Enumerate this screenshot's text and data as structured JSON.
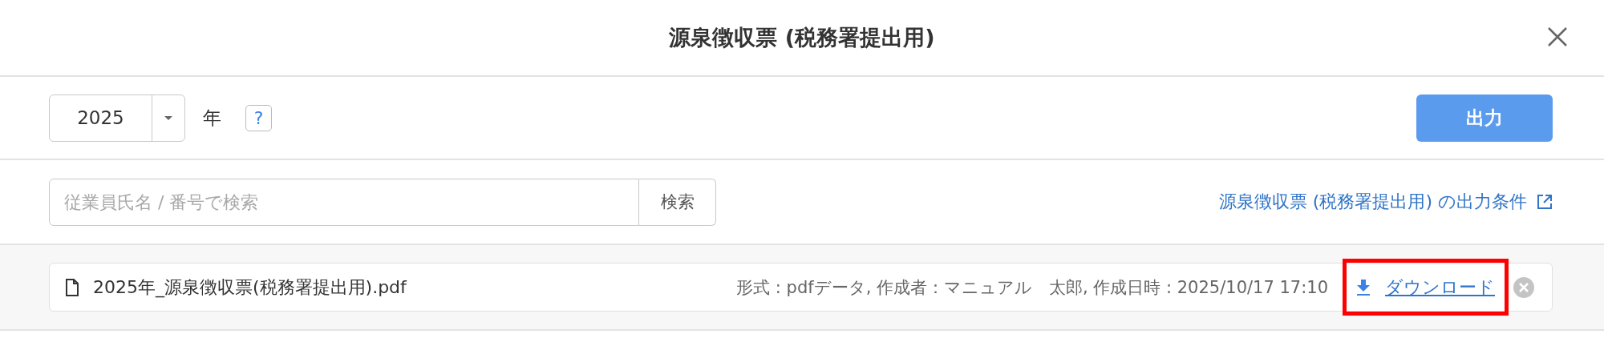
{
  "dialog": {
    "title": "源泉徴収票 (税務署提出用)"
  },
  "toolbar": {
    "year": "2025",
    "year_unit": "年",
    "help": "?",
    "output_button": "出力"
  },
  "search": {
    "placeholder": "従業員氏名 / 番号で検索",
    "button": "検索",
    "conditions_link": "源泉徴収票 (税務署提出用) の出力条件"
  },
  "files": [
    {
      "name": "2025年_源泉徴収票(税務署提出用).pdf",
      "meta": "形式 : pdfデータ, 作成者：マニュアル　太郎, 作成日時 : 2025/10/17 17:10",
      "download": "ダウンロード",
      "highlighted": true
    }
  ]
}
